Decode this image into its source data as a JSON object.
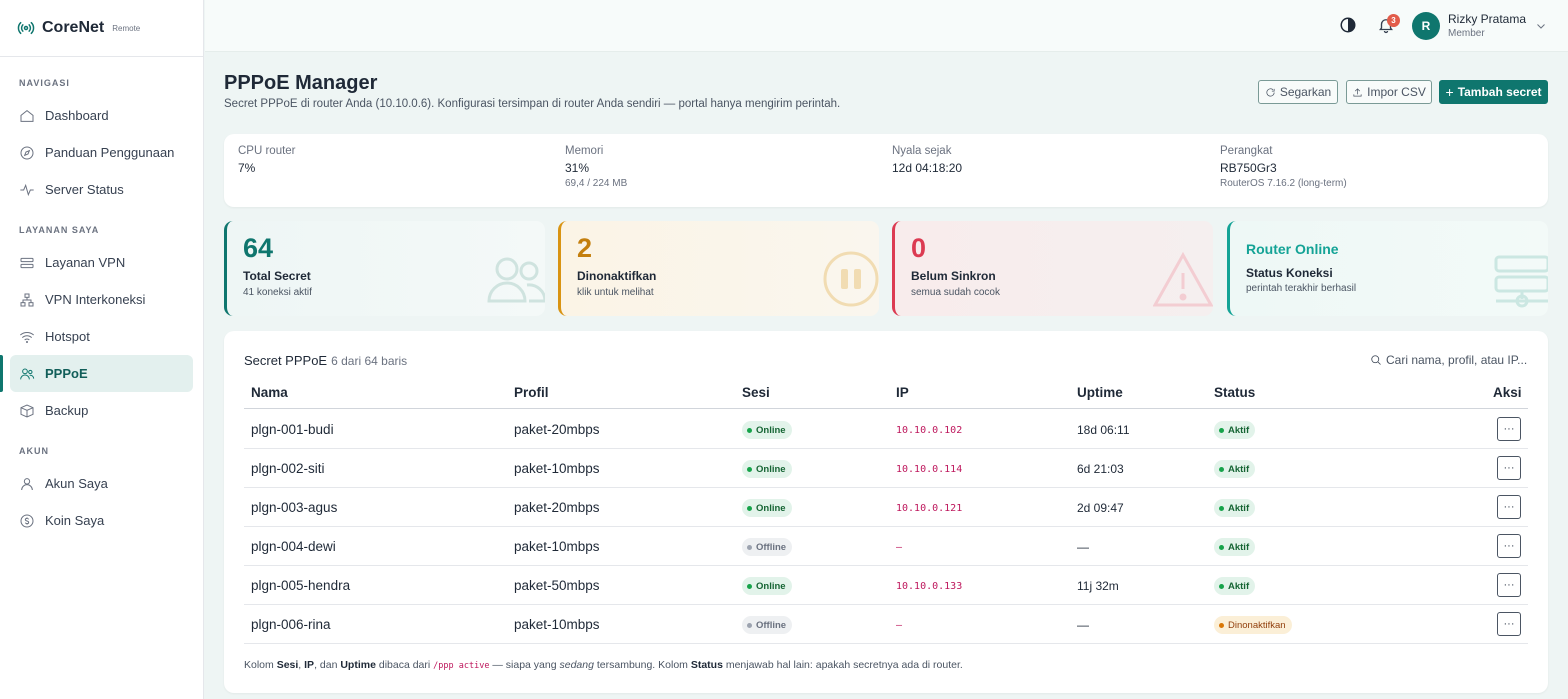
{
  "app": {
    "name": "CoreNet",
    "tag": "Remote"
  },
  "sidebar": {
    "sections": [
      {
        "title": "NAVIGASI",
        "items": [
          {
            "label": "Dashboard",
            "icon": "home-icon"
          },
          {
            "label": "Panduan Penggunaan",
            "icon": "compass-icon"
          },
          {
            "label": "Server Status",
            "icon": "pulse-icon"
          }
        ]
      },
      {
        "title": "LAYANAN SAYA",
        "items": [
          {
            "label": "Layanan VPN",
            "icon": "server-icon"
          },
          {
            "label": "VPN Interkoneksi",
            "icon": "network-icon"
          },
          {
            "label": "Hotspot",
            "icon": "wifi-icon"
          },
          {
            "label": "PPPoE",
            "icon": "users-icon",
            "active": true
          },
          {
            "label": "Backup",
            "icon": "box-icon"
          }
        ]
      },
      {
        "title": "AKUN",
        "items": [
          {
            "label": "Akun Saya",
            "icon": "user-icon"
          },
          {
            "label": "Koin Saya",
            "icon": "coin-icon"
          }
        ]
      }
    ]
  },
  "topbar": {
    "notifications": "3",
    "user": {
      "initial": "R",
      "name": "Rizky Pratama",
      "role": "Member"
    }
  },
  "page": {
    "title": "PPPoE Manager",
    "subtitle": "Secret PPPoE di router Anda (10.10.0.6). Konfigurasi tersimpan di router Anda sendiri — portal hanya mengirim perintah.",
    "buttons": {
      "refresh": "Segarkan",
      "import": "Impor CSV",
      "add": "Tambah secret"
    }
  },
  "stats": {
    "cpu": {
      "label": "CPU router",
      "value": "7%"
    },
    "memory": {
      "label": "Memori",
      "value": "31%",
      "note": "69,4 / 224 MB"
    },
    "uptime": {
      "label": "Nyala sejak",
      "value": "12d 04:18:20"
    },
    "device": {
      "label": "Perangkat",
      "value": "RB750Gr3",
      "note": "RouterOS 7.16.2 (long-term)"
    }
  },
  "kpis": {
    "total": {
      "number": "64",
      "title": "Total Secret",
      "sub": "41 koneksi aktif"
    },
    "disabled": {
      "number": "2",
      "title": "Dinonaktifkan",
      "sub": "klik untuk melihat"
    },
    "unsynced": {
      "number": "0",
      "title": "Belum Sinkron",
      "sub": "semua sudah cocok"
    },
    "router": {
      "heading": "Router Online",
      "title": "Status Koneksi",
      "sub": "perintah terakhir berhasil"
    }
  },
  "table": {
    "title": "Secret PPPoE",
    "count": "6 dari 64 baris",
    "search_placeholder": "Cari nama, profil, atau IP...",
    "columns": [
      "Nama",
      "Profil",
      "Sesi",
      "IP",
      "Uptime",
      "Status",
      "Aksi"
    ],
    "rows": [
      {
        "name": "plgn-001-budi",
        "profile": "paket-20mbps",
        "session": "Online",
        "ip": "10.10.0.102",
        "uptime": "18d 06:11",
        "status": "Aktif"
      },
      {
        "name": "plgn-002-siti",
        "profile": "paket-10mbps",
        "session": "Online",
        "ip": "10.10.0.114",
        "uptime": "6d 21:03",
        "status": "Aktif"
      },
      {
        "name": "plgn-003-agus",
        "profile": "paket-20mbps",
        "session": "Online",
        "ip": "10.10.0.121",
        "uptime": "2d 09:47",
        "status": "Aktif"
      },
      {
        "name": "plgn-004-dewi",
        "profile": "paket-10mbps",
        "session": "Offline",
        "ip": "—",
        "uptime": "—",
        "status": "Aktif"
      },
      {
        "name": "plgn-005-hendra",
        "profile": "paket-50mbps",
        "session": "Online",
        "ip": "10.10.0.133",
        "uptime": "11j 32m",
        "status": "Aktif"
      },
      {
        "name": "plgn-006-rina",
        "profile": "paket-10mbps",
        "session": "Offline",
        "ip": "—",
        "uptime": "—",
        "status": "Dinonaktifkan"
      }
    ],
    "action_label": "···",
    "footnote": {
      "p1": "Kolom ",
      "b1": "Sesi",
      "p2": ", ",
      "b2": "IP",
      "p3": ", dan ",
      "b3": "Uptime",
      "p4": " dibaca dari ",
      "code": "/ppp active",
      "p5": " — siapa yang ",
      "em": "sedang",
      "p6": " tersambung. Kolom ",
      "b4": "Status",
      "p7": " menjawab hal lain: apakah secretnya ada di router."
    }
  },
  "colors": {
    "brand": "#0f766e",
    "warning": "#d99413",
    "danger": "#dc3b52",
    "online": "#14a396"
  }
}
